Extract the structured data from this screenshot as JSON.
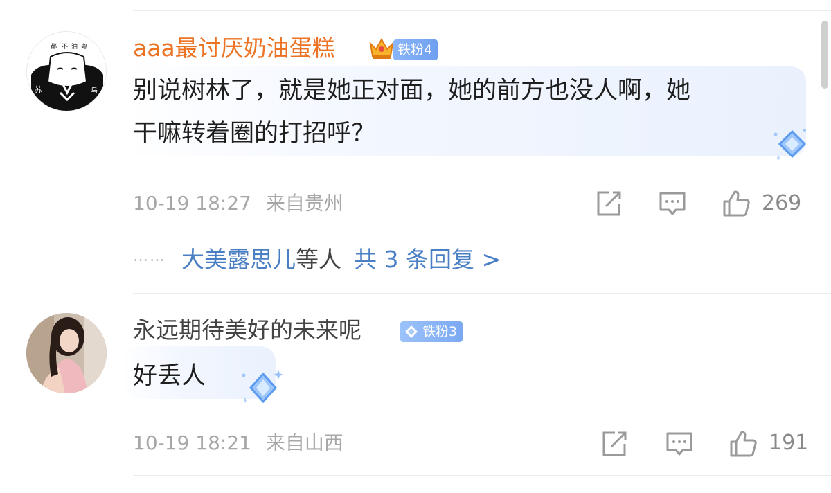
{
  "comments": [
    {
      "username": "aaa最讨厌奶油蛋糕",
      "badge_label": "铁粉4",
      "text_lines": [
        "别说树林了，就是她正对面，她的前方也没人啊，她",
        "干嘛转着圈的打招呼？"
      ],
      "date": "10-19 18:27",
      "location": "来自贵州",
      "like_count": "269",
      "replies": {
        "dots": "……",
        "names": "大美露思儿",
        "suffix": "等人",
        "count_label": "共 3 条回复 >"
      },
      "avatar_text": [
        "都",
        "不",
        "油",
        "粤",
        "苏",
        "乌"
      ]
    },
    {
      "username": "永远期待美好的未来呢",
      "badge_label": "铁粉3",
      "text_lines": [
        "好丢人"
      ],
      "date": "10-19 18:21",
      "location": "来自山西",
      "like_count": "191"
    }
  ],
  "icons": {
    "share": "share-icon",
    "comment": "comment-icon",
    "like": "like-icon",
    "crown": "crown-icon",
    "gem": "diamond-gem-icon"
  },
  "colors": {
    "username_highlight": "#ec7324",
    "username_normal": "#444444",
    "link_blue": "#4a7fc4",
    "badge_blue": "#7ba9f2",
    "meta_gray": "#a7a7a7"
  }
}
